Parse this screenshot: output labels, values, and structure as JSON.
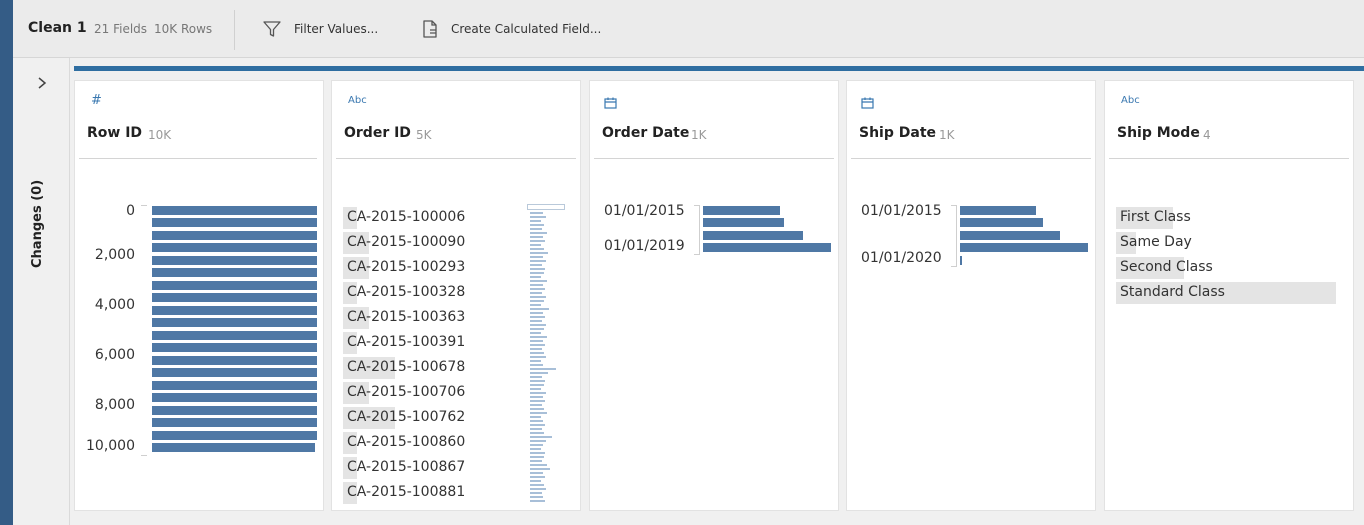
{
  "toolbar": {
    "title": "Clean 1",
    "fields": "21 Fields",
    "rows": "10K Rows",
    "filter_label": "Filter Values...",
    "calc_label": "Create Calculated Field..."
  },
  "changes": {
    "label": "Changes (0)"
  },
  "colors": {
    "accent": "#2f6ea1",
    "bar": "#4f78a5",
    "sidebar": "#345c86"
  },
  "cards": {
    "row_id": {
      "type": "#",
      "name": "Row ID",
      "count": "10K",
      "axis": [
        "0",
        "2,000",
        "4,000",
        "6,000",
        "8,000",
        "10,000"
      ]
    },
    "order_id": {
      "type": "Abc",
      "name": "Order ID",
      "count": "5K",
      "values": [
        "CA-2015-100006",
        "CA-2015-100090",
        "CA-2015-100293",
        "CA-2015-100328",
        "CA-2015-100363",
        "CA-2015-100391",
        "CA-2015-100678",
        "CA-2015-100706",
        "CA-2015-100762",
        "CA-2015-100860",
        "CA-2015-100867",
        "CA-2015-100881"
      ]
    },
    "order_date": {
      "type": "calendar-icon",
      "name": "Order Date",
      "count": "1K",
      "labels": [
        "01/01/2015",
        "01/01/2019"
      ]
    },
    "ship_date": {
      "type": "calendar-icon",
      "name": "Ship Date",
      "count": "1K",
      "labels": [
        "01/01/2015",
        "01/01/2020"
      ]
    },
    "ship_mode": {
      "type": "Abc",
      "name": "Ship Mode",
      "count": "4",
      "values": [
        "First Class",
        "Same Day",
        "Second Class",
        "Standard Class"
      ],
      "shares": [
        0.26,
        0.09,
        0.31,
        1.0
      ]
    }
  }
}
